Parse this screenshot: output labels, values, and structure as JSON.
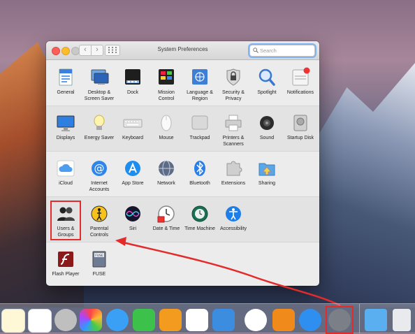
{
  "window": {
    "title": "System Preferences",
    "search_placeholder": "Search"
  },
  "sections": [
    {
      "items": [
        {
          "label": "General",
          "icon": "general-icon"
        },
        {
          "label": "Desktop & Screen Saver",
          "icon": "desktop-screensaver-icon"
        },
        {
          "label": "Dock",
          "icon": "dock-icon"
        },
        {
          "label": "Mission Control",
          "icon": "mission-control-icon"
        },
        {
          "label": "Language & Region",
          "icon": "language-region-icon"
        },
        {
          "label": "Security & Privacy",
          "icon": "security-privacy-icon"
        },
        {
          "label": "Spotlight",
          "icon": "spotlight-icon"
        },
        {
          "label": "Notifications",
          "icon": "notifications-icon"
        }
      ]
    },
    {
      "items": [
        {
          "label": "Displays",
          "icon": "displays-icon"
        },
        {
          "label": "Energy Saver",
          "icon": "energy-saver-icon"
        },
        {
          "label": "Keyboard",
          "icon": "keyboard-icon"
        },
        {
          "label": "Mouse",
          "icon": "mouse-icon"
        },
        {
          "label": "Trackpad",
          "icon": "trackpad-icon"
        },
        {
          "label": "Printers & Scanners",
          "icon": "printer-icon"
        },
        {
          "label": "Sound",
          "icon": "sound-icon"
        },
        {
          "label": "Startup Disk",
          "icon": "startup-disk-icon"
        }
      ]
    },
    {
      "items": [
        {
          "label": "iCloud",
          "icon": "icloud-icon"
        },
        {
          "label": "Internet Accounts",
          "icon": "internet-accounts-icon"
        },
        {
          "label": "App Store",
          "icon": "app-store-icon"
        },
        {
          "label": "Network",
          "icon": "network-icon"
        },
        {
          "label": "Bluetooth",
          "icon": "bluetooth-icon"
        },
        {
          "label": "Extensions",
          "icon": "extensions-icon"
        },
        {
          "label": "Sharing",
          "icon": "sharing-icon"
        }
      ]
    },
    {
      "items": [
        {
          "label": "Users & Groups",
          "icon": "users-groups-icon"
        },
        {
          "label": "Parental Controls",
          "icon": "parental-controls-icon"
        },
        {
          "label": "Siri",
          "icon": "siri-icon"
        },
        {
          "label": "Date & Time",
          "icon": "date-time-icon"
        },
        {
          "label": "Time Machine",
          "icon": "time-machine-icon"
        },
        {
          "label": "Accessibility",
          "icon": "accessibility-icon"
        }
      ]
    },
    {
      "items": [
        {
          "label": "Flash Player",
          "icon": "flash-player-icon"
        },
        {
          "label": "FUSE",
          "icon": "fuse-icon"
        }
      ]
    }
  ],
  "dock": {
    "items": [
      "notes-icon",
      "reminders-icon",
      "photo-booth-icon",
      "photos-icon",
      "messages-icon",
      "facetime-icon",
      "pages-icon",
      "numbers-icon",
      "keynote-icon",
      "itunes-icon",
      "ibooks-icon",
      "app-store-icon",
      "system-preferences-icon",
      "downloads-folder-icon",
      "trash-icon"
    ]
  }
}
